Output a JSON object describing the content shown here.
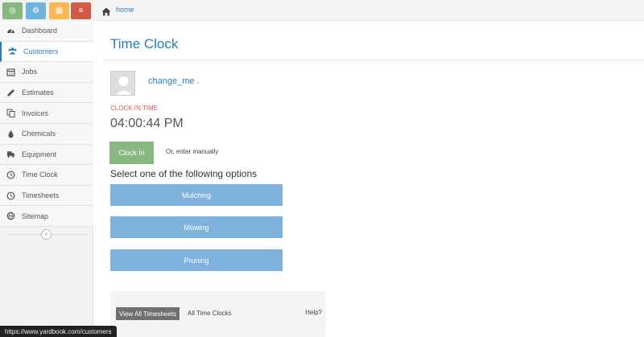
{
  "shortcuts": [
    {
      "icon": "signal-icon",
      "color": "#87b87f",
      "glyph": "◎"
    },
    {
      "icon": "cogs-icon",
      "color": "#6fb3e0",
      "glyph": "⚙"
    },
    {
      "icon": "calculator-icon",
      "color": "#ffb752",
      "glyph": "▦"
    },
    {
      "icon": "list-icon",
      "color": "#d15b47",
      "glyph": "≡"
    }
  ],
  "sidebar": {
    "items": [
      {
        "label": "Dashboard",
        "icon": "tachometer-icon",
        "active": false
      },
      {
        "label": "Customers",
        "icon": "users-icon",
        "active": true
      },
      {
        "label": "Jobs",
        "icon": "calendar-icon",
        "active": false
      },
      {
        "label": "Estimates",
        "icon": "pencil-icon",
        "active": false
      },
      {
        "label": "Invoices",
        "icon": "copy-icon",
        "active": false
      },
      {
        "label": "Chemicals",
        "icon": "tint-icon",
        "active": false
      },
      {
        "label": "Equipment",
        "icon": "truck-icon",
        "active": false
      },
      {
        "label": "Time Clock",
        "icon": "clock-icon",
        "active": false
      },
      {
        "label": "Timesheets",
        "icon": "clock-icon",
        "active": false
      },
      {
        "label": "Sitemap",
        "icon": "globe-icon",
        "active": false
      }
    ],
    "collapse_glyph": "«"
  },
  "breadcrumb": {
    "home_label": "home"
  },
  "main": {
    "title": "Time Clock",
    "user_name": "change_me .",
    "clock_in_label": "CLOCK IN TIME",
    "clock_in_time": "04:00:44 PM",
    "clock_in_button": "Clock In",
    "manual_link": "Or, enter manually",
    "options_heading": "Select one of the following options",
    "options": [
      "Mulching",
      "Mowing",
      "Pruning"
    ]
  },
  "footer": {
    "view_all_button": "View All Timesheets",
    "all_time_clocks": "All Time Clocks",
    "help": "Help?"
  },
  "status_bar": {
    "url": "https://www.yardbook.com/customers"
  },
  "colors": {
    "accent": "#2a7bbd",
    "clock_in_green": "#87b87f",
    "option_blue": "#7fb2dd",
    "clock_label_red": "#d15b47"
  }
}
